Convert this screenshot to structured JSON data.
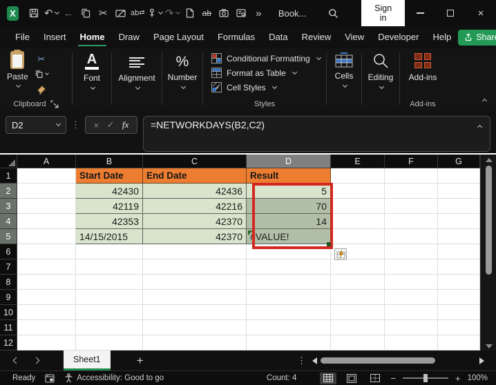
{
  "titlebar": {
    "title": "Book...",
    "sign_in": "Sign in"
  },
  "icons": {
    "undo": "↶",
    "redo": "↷",
    "back": "←",
    "cut": "✂",
    "swap": "⇄",
    "ab": "ab",
    "overflow": "»",
    "dots_v": "⋮",
    "close": "×",
    "check": "✓",
    "x_small": "×",
    "minus": "−",
    "plus": "+",
    "percent": "%",
    "font_a": "A",
    "logo_x": "X"
  },
  "menubar": {
    "items": [
      "File",
      "Insert",
      "Home",
      "Draw",
      "Page Layout",
      "Formulas",
      "Data",
      "Review",
      "View",
      "Developer",
      "Help"
    ],
    "active_item": "Home",
    "share": "Share"
  },
  "ribbon": {
    "paste": "Paste",
    "clipboard_group": "Clipboard",
    "font": "Font",
    "alignment": "Alignment",
    "number": "Number",
    "conditional_formatting": "Conditional Formatting",
    "format_as_table": "Format as Table",
    "cell_styles": "Cell Styles",
    "styles_group": "Styles",
    "cells": "Cells",
    "editing": "Editing",
    "addins": "Add-ins",
    "addins_group": "Add-ins"
  },
  "formula_bar": {
    "name_box": "D2",
    "fx": "fx",
    "formula": "=NETWORKDAYS(B2,C2)"
  },
  "grid": {
    "columns": [
      "A",
      "B",
      "C",
      "D",
      "E",
      "F",
      "G"
    ],
    "row_numbers": [
      "1",
      "2",
      "3",
      "4",
      "5",
      "6",
      "7",
      "8",
      "9",
      "10",
      "11",
      "12"
    ],
    "selected_column": "D",
    "selected_rows": [
      "2",
      "3",
      "4",
      "5"
    ]
  },
  "table": {
    "headers": {
      "start": "Start Date",
      "end": "End Date",
      "result": "Result"
    },
    "rows": [
      {
        "start": "42430",
        "end": "42436",
        "result": "5"
      },
      {
        "start": "42119",
        "end": "42216",
        "result": "70"
      },
      {
        "start": "42353",
        "end": "42370",
        "result": "14"
      },
      {
        "start": "14/15/2015",
        "end": "42370",
        "result": "#VALUE!"
      }
    ]
  },
  "sheet_bar": {
    "tabs": [
      "Sheet1"
    ],
    "active_tab": "Sheet1",
    "add": "+"
  },
  "status_bar": {
    "ready": "Ready",
    "accessibility": "Accessibility: Good to go",
    "count": "Count: 4",
    "zoom_level": "100%"
  },
  "colors": {
    "excel_green": "#1f8b4d",
    "header_orange": "#ED7D31",
    "cell_green": "#D8E4CC",
    "selection_shade": "#B2BFA8",
    "annotation_red": "#D3281E"
  }
}
